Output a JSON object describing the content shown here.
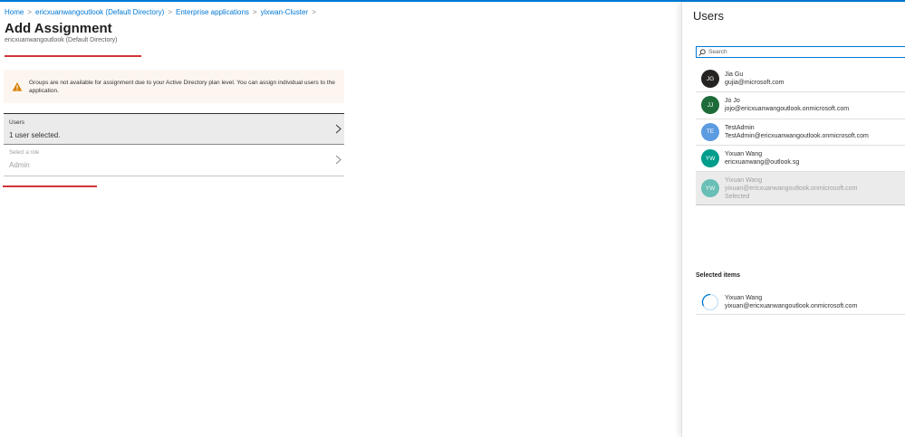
{
  "breadcrumb": [
    "Home",
    "ericxuanwangoutlook (Default Directory)",
    "Enterprise applications",
    "yixwan-Cluster"
  ],
  "breadcrumb_separator": ">",
  "page": {
    "title": "Add Assignment",
    "subtitle": "ericxuanwangoutlook (Default Directory)"
  },
  "warning": {
    "icon": "warning-triangle-icon",
    "text": "Groups are not available for assignment due to your Active Directory plan level. You can assign individual users to the application."
  },
  "users_field": {
    "label": "Users",
    "value": "1 user selected."
  },
  "role_field": {
    "label": "Select a role",
    "value": "Admin"
  },
  "panel": {
    "title": "Users",
    "search_placeholder": "Search",
    "users": [
      {
        "initials": "JG",
        "name": "Jia Gu",
        "email": "gujia@microsoft.com",
        "color": "#252423",
        "selected": false
      },
      {
        "initials": "JJ",
        "name": "Jo Jo",
        "email": "jojo@ericxuanwangoutlook.onmicrosoft.com",
        "color": "#1e6b3a",
        "selected": false
      },
      {
        "initials": "TE",
        "name": "TestAdmin",
        "email": "TestAdmin@ericxuanwangoutlook.onmicrosoft.com",
        "color": "#5c9be0",
        "selected": false
      },
      {
        "initials": "YW",
        "name": "Yixuan Wang",
        "email": "ericxuanwang@outlook.sg",
        "color": "#009c8c",
        "selected": false
      },
      {
        "initials": "YW",
        "name": "Yixuan Wang",
        "email": "yixuan@ericxuanwangoutlook.onmicrosoft.com",
        "color": "#009c8c",
        "selected": true,
        "status": "Selected"
      }
    ],
    "selected_heading": "Selected items",
    "selected_items": [
      {
        "name": "Yixuan Wang",
        "email": "yixuan@ericxuanwangoutlook.onmicrosoft.com"
      }
    ]
  },
  "colors": {
    "accent": "#0078d4",
    "warning": "#d97e00",
    "annotation_red": "#d13438"
  }
}
